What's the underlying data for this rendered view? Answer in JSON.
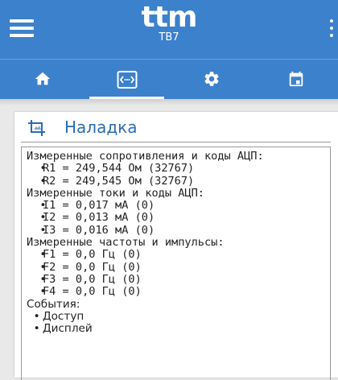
{
  "header": {
    "brand": "ttm",
    "device": "ТВ7"
  },
  "tabs": [
    {
      "icon": "home-icon",
      "active": false
    },
    {
      "icon": "code-icon",
      "active": true
    },
    {
      "icon": "gear-icon",
      "active": false
    },
    {
      "icon": "calendar-icon",
      "active": false
    }
  ],
  "card": {
    "title": "Наладка",
    "sections": [
      {
        "heading": "Измеренные сопротивления и коды АЦП:",
        "items": [
          "R1 = 249,544 Ом (32767)",
          "R2 = 249,545 Ом (32767)"
        ]
      },
      {
        "heading": "Измеренные токи и коды АЦП:",
        "items": [
          "I1 = 0,017 мА (0)",
          "I2 = 0,013 мА (0)",
          "I3 = 0,016 мА (0)"
        ]
      },
      {
        "heading": "Измеренные частоты и импульсы:",
        "items": [
          "F1 = 0,0 Гц (0)",
          "F2 = 0,0 Гц (0)",
          "F3 = 0,0 Гц (0)",
          "F4 = 0,0 Гц (0)"
        ]
      },
      {
        "heading": "События:",
        "items": [
          "Доступ",
          "Дисплей"
        ]
      }
    ]
  },
  "colors": {
    "primary": "#3c81cc",
    "title": "#2a6cb3",
    "background": "#e9e9e9"
  }
}
